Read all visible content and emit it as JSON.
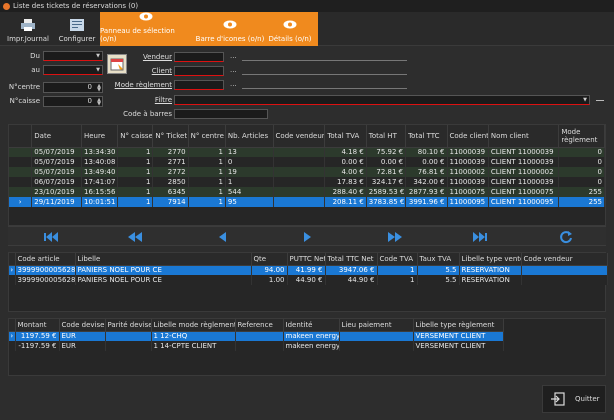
{
  "window": {
    "title": "Liste des tickets de réservations (0)"
  },
  "toolbar": {
    "print": "Impr.Journal",
    "configure": "Configurer",
    "selection_panel": "Panneau de sélection (o/n)",
    "icon_bar": "Barre d'icones (o/n)",
    "details": "Détails (o/n)"
  },
  "filters": {
    "du": "Du",
    "au": "au",
    "ncentre": "N°centre",
    "ncaisse": "N°caisse",
    "ncentre_value": "0",
    "ncaisse_value": "0",
    "vendeur": "Vendeur",
    "client": "Client",
    "mode_reglement": "Mode règlement",
    "filtre": "Filtre",
    "code_barres": "Code à barres",
    "dots": "..."
  },
  "tickets": {
    "columns": [
      "Date",
      "Heure",
      "N° caisse",
      "N° Ticket",
      "N° centre",
      "Nb. Articles",
      "Code vendeur",
      "Total TVA",
      "Total HT",
      "Total TTC",
      "Code client",
      "Nom client",
      "Mode règlement"
    ],
    "rows": [
      [
        "05/07/2019",
        "13:34:30",
        "1",
        "2770",
        "1",
        "13",
        "",
        "4.18 €",
        "75.92 €",
        "80.10 €",
        "11000039",
        "CLIENT  11000039",
        "0"
      ],
      [
        "05/07/2019",
        "13:40:08",
        "1",
        "2771",
        "1",
        "0",
        "",
        "0.00 €",
        "0.00 €",
        "0.00 €",
        "11000039",
        "CLIENT  11000039",
        "0"
      ],
      [
        "05/07/2019",
        "13:49:40",
        "1",
        "2772",
        "1",
        "19",
        "",
        "4.00 €",
        "72.81 €",
        "76.81 €",
        "11000002",
        "CLIENT  11000002",
        "0"
      ],
      [
        "06/07/2019",
        "17:41:07",
        "1",
        "2850",
        "1",
        "1",
        "",
        "17.83 €",
        "324.17 €",
        "342.00 €",
        "11000039",
        "CLIENT  11000039",
        "0"
      ],
      [
        "23/10/2019",
        "16:15:56",
        "1",
        "6345",
        "1",
        "544",
        "",
        "288.40 €",
        "2589.53 €",
        "2877.93 €",
        "11000075",
        "CLIENT  11000075",
        "255"
      ],
      [
        "29/11/2019",
        "10:01:51",
        "1",
        "7914",
        "1",
        "95",
        "",
        "208.11 €",
        "3783.85 €",
        "3991.96 €",
        "11000095",
        "CLIENT  11000095",
        "255"
      ]
    ]
  },
  "articles": {
    "columns": [
      "Code article",
      "Libelle",
      "Qte",
      "PUTTC Net",
      "Total TTC Net",
      "Code TVA",
      "Taux TVA",
      "Libelle type vente",
      "Code vendeur"
    ],
    "rows": [
      [
        "3999900005628",
        "PANIERS NOEL POUR CE",
        "94.00",
        "41.99 €",
        "3947.06 €",
        "1",
        "5.5",
        "RESERVATION",
        ""
      ],
      [
        "3999900005628",
        "PANIERS NOEL POUR CE",
        "1.00",
        "44.90 €",
        "44.90 €",
        "1",
        "5.5",
        "RESERVATION",
        ""
      ]
    ]
  },
  "payments": {
    "columns": [
      "Montant",
      "Code devise",
      "Parité devise",
      "Libelle mode règlement",
      "Reference",
      "Identité",
      "Lieu paiement",
      "Libelle type règlement"
    ],
    "rows": [
      [
        "1197.59 €",
        "EUR",
        "",
        "1  12-CHQ",
        "",
        "makeen energy",
        "",
        "VERSEMENT CLIENT"
      ],
      [
        "-1197.59 €",
        "EUR",
        "",
        "1  14-CPTE CLIENT",
        "",
        "makeen energy",
        "",
        "VERSEMENT CLIENT"
      ]
    ]
  },
  "footer": {
    "quit": "Quitter"
  },
  "colors": {
    "accent": "#f08a1e",
    "selection": "#1a78d4",
    "nav_icon": "#3a8fe0"
  }
}
